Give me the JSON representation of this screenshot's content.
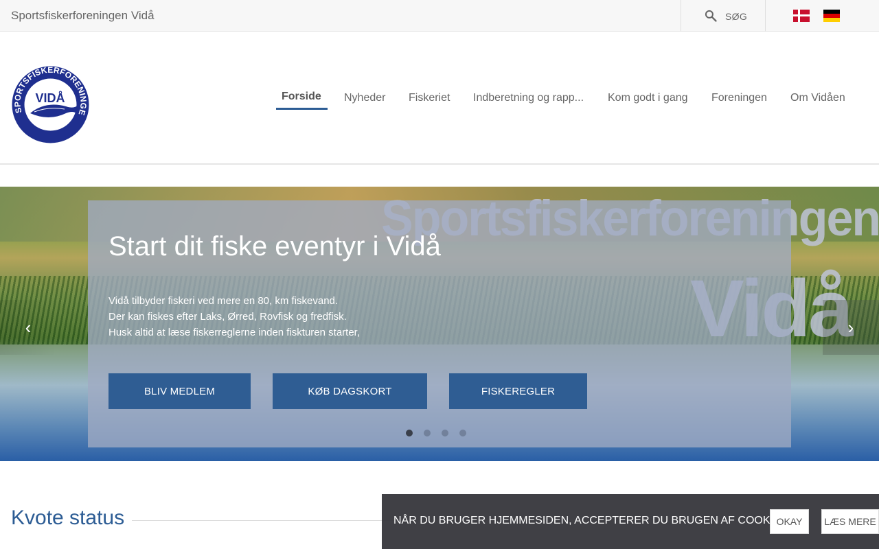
{
  "topbar": {
    "site_name": "Sportsfiskerforeningen Vidå",
    "search_label": "SØG",
    "search_icon": "search-icon",
    "languages": [
      "Dansk",
      "Deutsch"
    ]
  },
  "logo": {
    "text_ring": "SPORTSFISKERFORENINGEN",
    "text_center": "VIDÅ"
  },
  "nav": {
    "items": [
      {
        "label": "Forside",
        "active": true
      },
      {
        "label": "Nyheder"
      },
      {
        "label": "Fiskeriet"
      },
      {
        "label": "Indberetning og rapp..."
      },
      {
        "label": "Kom godt i gang"
      },
      {
        "label": "Foreningen"
      },
      {
        "label": "Om Vidåen"
      }
    ]
  },
  "hero": {
    "watermark_line1": "Sportsfiskerforeningen",
    "watermark_line2": "Vidå",
    "title": "Start dit fiske eventyr i Vidå",
    "lines": [
      "Vidå tilbyder fiskeri ved mere en 80, km fiskevand.",
      "Der kan fiskes efter Laks, Ørred, Rovfisk og fredfisk.",
      "Husk altid at læse fiskerreglerne inden fiskturen starter,"
    ],
    "buttons": [
      "BLIV MEDLEM",
      "KØB DAGSKORT",
      "FISKEREGLER"
    ],
    "slides_total": 4,
    "active_slide": 1,
    "prev_icon": "chevron-left-icon",
    "next_icon": "chevron-right-icon"
  },
  "section": {
    "title": "Kvote status"
  },
  "cookie": {
    "text": "NÅR DU BRUGER HJEMMESIDEN, ACCEPTERER DU BRUGEN AF COOKIES.",
    "ok": "OKAY",
    "more": "LÆS MERE"
  },
  "colors": {
    "primary": "#2f5d93",
    "link_blue": "#2c5c94",
    "overlay": "#a0aac3"
  }
}
